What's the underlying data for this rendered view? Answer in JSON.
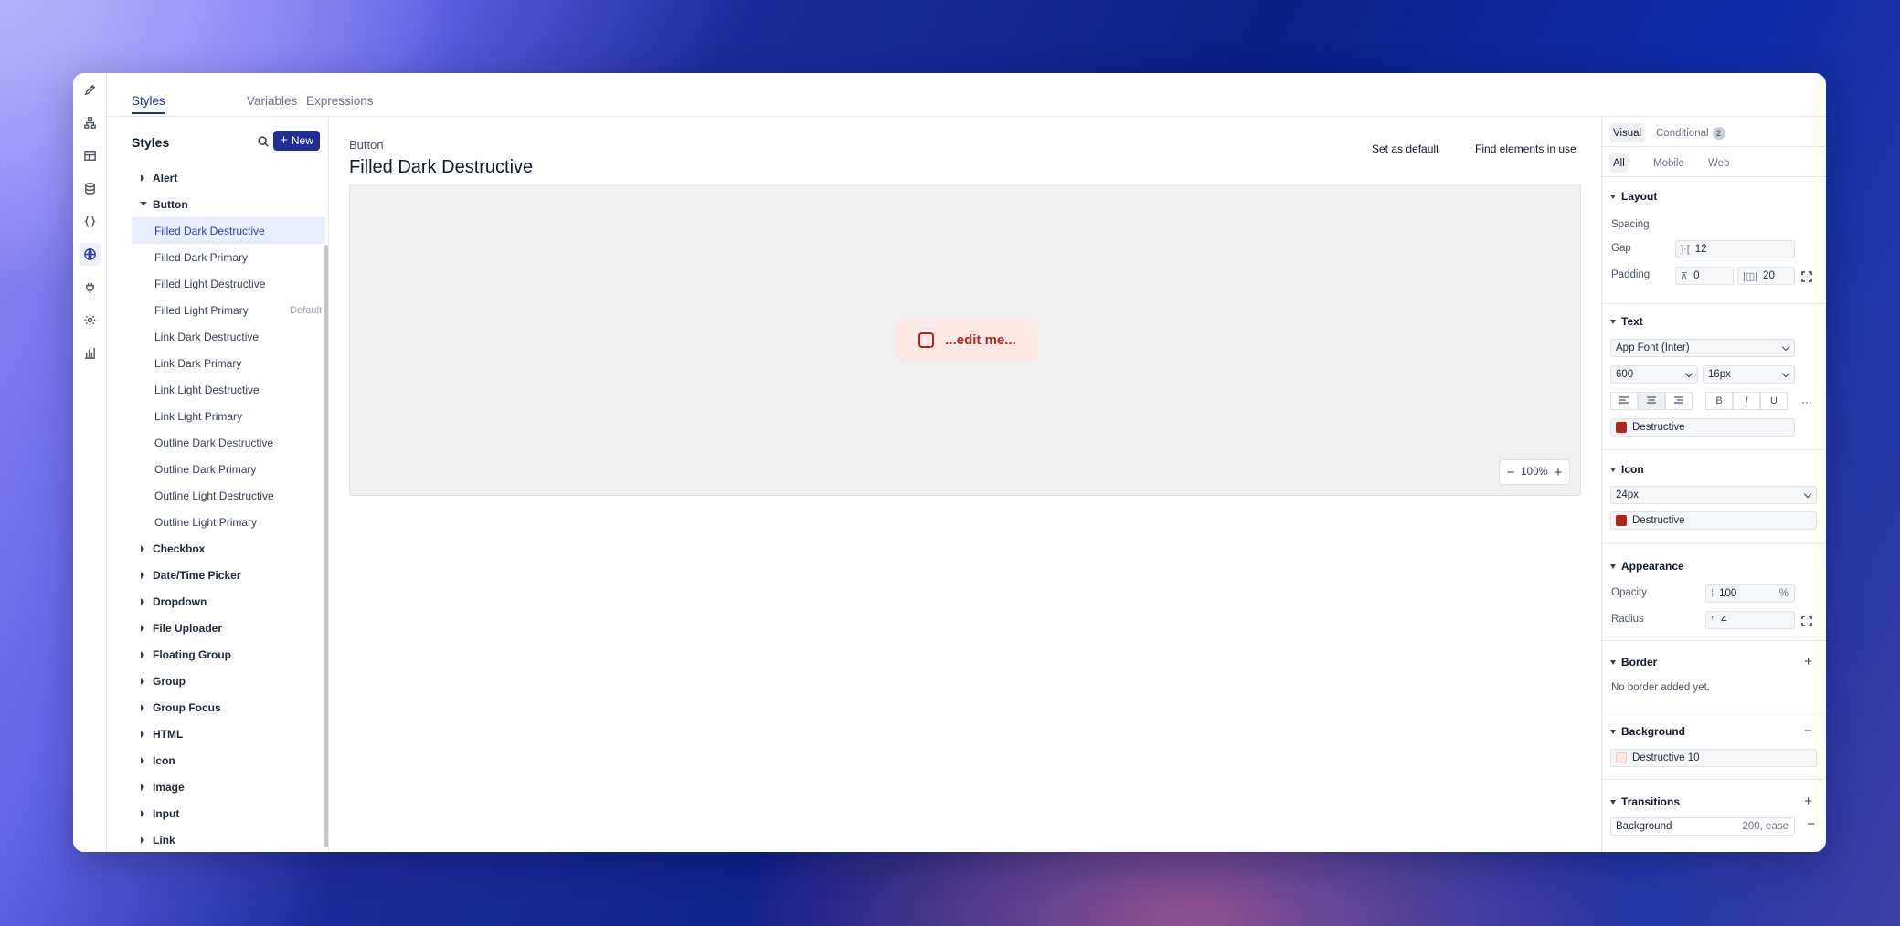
{
  "rail": {
    "icons": [
      "pencil-icon",
      "hierarchy-icon",
      "layout-icon",
      "database-icon",
      "code-braces-icon",
      "globe-icon",
      "plug-icon",
      "gear-icon",
      "chart-icon"
    ]
  },
  "top_tabs": [
    {
      "label": "Styles",
      "active": true
    },
    {
      "label": "Variables",
      "active": false
    },
    {
      "label": "Expressions",
      "active": false
    }
  ],
  "styles_panel": {
    "title": "Styles",
    "new_label": "New",
    "tree": [
      {
        "kind": "group",
        "label": "Alert",
        "open": false
      },
      {
        "kind": "group",
        "label": "Button",
        "open": true
      },
      {
        "kind": "item",
        "label": "Filled Dark Destructive",
        "selected": true
      },
      {
        "kind": "item",
        "label": "Filled Dark Primary"
      },
      {
        "kind": "item",
        "label": "Filled Light Destructive"
      },
      {
        "kind": "item",
        "label": "Filled Light Primary",
        "tag": "Default"
      },
      {
        "kind": "item",
        "label": "Link Dark Destructive"
      },
      {
        "kind": "item",
        "label": "Link Dark Primary"
      },
      {
        "kind": "item",
        "label": "Link Light Destructive"
      },
      {
        "kind": "item",
        "label": "Link Light Primary"
      },
      {
        "kind": "item",
        "label": "Outline Dark Destructive"
      },
      {
        "kind": "item",
        "label": "Outline Dark Primary"
      },
      {
        "kind": "item",
        "label": "Outline Light Destructive"
      },
      {
        "kind": "item",
        "label": "Outline Light Primary"
      },
      {
        "kind": "group",
        "label": "Checkbox",
        "open": false
      },
      {
        "kind": "group",
        "label": "Date/Time Picker",
        "open": false
      },
      {
        "kind": "group",
        "label": "Dropdown",
        "open": false
      },
      {
        "kind": "group",
        "label": "File Uploader",
        "open": false
      },
      {
        "kind": "group",
        "label": "Floating Group",
        "open": false
      },
      {
        "kind": "group",
        "label": "Group",
        "open": false
      },
      {
        "kind": "group",
        "label": "Group Focus",
        "open": false
      },
      {
        "kind": "group",
        "label": "HTML",
        "open": false
      },
      {
        "kind": "group",
        "label": "Icon",
        "open": false
      },
      {
        "kind": "group",
        "label": "Image",
        "open": false
      },
      {
        "kind": "group",
        "label": "Input",
        "open": false
      },
      {
        "kind": "group",
        "label": "Link",
        "open": false
      }
    ]
  },
  "main": {
    "breadcrumb": "Button",
    "title": "Filled Dark Destructive",
    "set_default_label": "Set as default",
    "find_elements_label": "Find elements in use",
    "preview_text": "...edit me...",
    "zoom": "100%"
  },
  "inspector": {
    "tabs": {
      "visual": "Visual",
      "conditional": "Conditional",
      "conditional_count": "2"
    },
    "platforms": [
      "All",
      "Mobile",
      "Web"
    ],
    "layout": {
      "title": "Layout",
      "spacing_label": "Spacing",
      "gap_label": "Gap",
      "gap_value": "12",
      "padding_label": "Padding",
      "padding_vertical": "0",
      "padding_horizontal": "20"
    },
    "text": {
      "title": "Text",
      "font": "App Font (Inter)",
      "weight": "600",
      "size": "16px",
      "color_name": "Destructive",
      "color": "#b3261e"
    },
    "icon": {
      "title": "Icon",
      "size": "24px",
      "color_name": "Destructive",
      "color": "#b3261e"
    },
    "appearance": {
      "title": "Appearance",
      "opacity_label": "Opacity",
      "opacity_value": "100",
      "opacity_unit": "%",
      "radius_label": "Radius",
      "radius_value": "4"
    },
    "border": {
      "title": "Border",
      "empty_text": "No border added yet."
    },
    "background": {
      "title": "Background",
      "color_name": "Destructive 10",
      "color": "#fde8e5"
    },
    "transitions": {
      "title": "Transitions",
      "property": "Background",
      "detail": "200, ease"
    }
  },
  "colors": {
    "accent": "#1f2d96",
    "destructive": "#b3261e",
    "destructive_10": "#fde8e5",
    "selected_row": "#e8eefb"
  }
}
